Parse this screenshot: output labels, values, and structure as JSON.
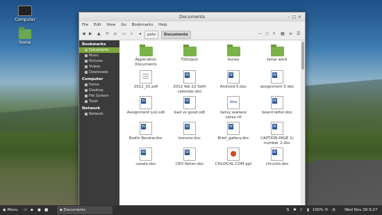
{
  "desktop": {
    "icons": [
      {
        "label": "Computer",
        "icon": "computer-icon"
      },
      {
        "label": "home",
        "icon": "home-folder-icon"
      }
    ]
  },
  "window": {
    "title": "Documents",
    "menu": [
      "File",
      "Edit",
      "View",
      "Go",
      "Bookmarks",
      "Help"
    ],
    "breadcrumbs": [
      "pete",
      "Documents"
    ],
    "sidebar": {
      "bookmarks_header": "Bookmarks",
      "bookmarks": [
        "Documents",
        "Music",
        "Pictures",
        "Videos",
        "Downloads"
      ],
      "computer_header": "Computer",
      "computer": [
        "Home",
        "Desktop",
        "File System",
        "Trash"
      ],
      "network_header": "Network",
      "network": [
        "Network"
      ]
    },
    "files": [
      {
        "name": "Application Documents",
        "type": "folder"
      },
      {
        "name": "FjOutput",
        "type": "folder"
      },
      {
        "name": "itunes",
        "type": "folder"
      },
      {
        "name": "temp work",
        "type": "folder"
      },
      {
        "name": "2012_01.pdf",
        "type": "pdf"
      },
      {
        "name": "2012 feb 22 faith calendar.doc",
        "type": "doc"
      },
      {
        "name": "Android 5.doc",
        "type": "doc"
      },
      {
        "name": "assignment 5.doc",
        "type": "doc"
      },
      {
        "name": "Assignment List.odt",
        "type": "doc"
      },
      {
        "name": "bad vs good.odt",
        "type": "doc"
      },
      {
        "name": "betsy wallace notes.rtf",
        "type": "abw"
      },
      {
        "name": "board letter.doc",
        "type": "doc"
      },
      {
        "name": "Bodhi Review.doc",
        "type": "doc"
      },
      {
        "name": "bonono.doc",
        "type": "doc"
      },
      {
        "name": "Brief_gallery.doc",
        "type": "doc"
      },
      {
        "name": "CAPTION PAGE 1) number 2.doc",
        "type": "doc"
      },
      {
        "name": "casale.doc",
        "type": "doc"
      },
      {
        "name": "CEO Notes.doc",
        "type": "doc"
      },
      {
        "name": "CHLOICAL.COM.ppt",
        "type": "ppt"
      },
      {
        "name": "chrucks.doc",
        "type": "doc"
      }
    ]
  },
  "panel": {
    "menu_label": "Menu",
    "task_label": "Documents",
    "battery": "100%",
    "clock": "Wed Nov 28  9:27"
  }
}
